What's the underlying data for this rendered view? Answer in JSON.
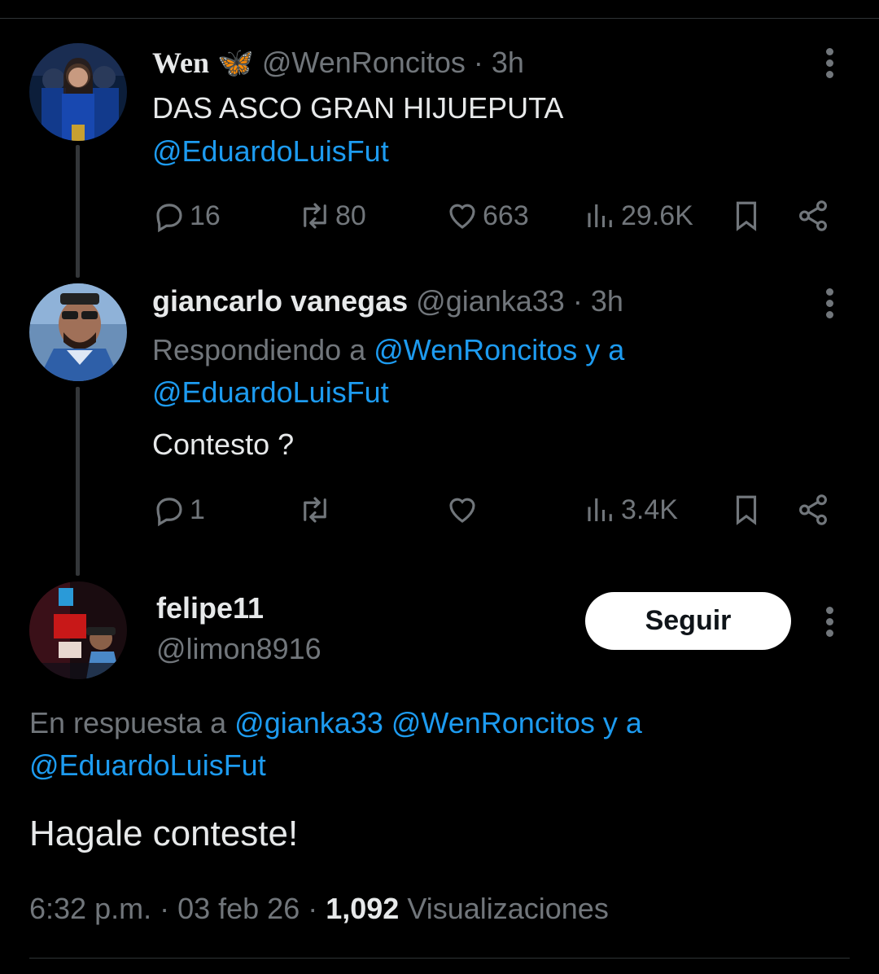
{
  "tweet1": {
    "name": "Wen",
    "emoji": "🦋",
    "handle": "@WenRoncitos",
    "dot": " · ",
    "time": "3h",
    "text": "DAS ASCO GRAN HIJUEPUTA",
    "mention": "@EduardoLuisFut",
    "replies": "16",
    "retweets": "80",
    "likes": "663",
    "views": "29.6K"
  },
  "tweet2": {
    "name": "giancarlo vanegas",
    "handle": "@gianka33",
    "dot": " · ",
    "time": "3h",
    "replying_prefix": "Respondiendo a",
    "replying_user": "@WenRoncitos",
    "replying_and": "y a",
    "replying_user2": "@EduardoLuisFut",
    "text": "Contesto ?",
    "replies": "1",
    "views": "3.4K"
  },
  "tweet3": {
    "name": "felipe11",
    "handle": "@limon8916",
    "follow_label": "Seguir",
    "reply_prefix": "En respuesta a",
    "reply_user1": "@gianka33",
    "reply_user2": "@WenRoncitos",
    "reply_and": "y a",
    "reply_user3": "@EduardoLuisFut",
    "text": "Hagale conteste!",
    "time": "6:32 p.m.",
    "sep": " · ",
    "date": "03 feb 26",
    "views_count": "1,092",
    "views_label": "Visualizaciones"
  },
  "colors": {
    "accent": "#1d9bf0",
    "muted": "#71767b",
    "text": "#e7e9ea",
    "background": "#000000"
  }
}
